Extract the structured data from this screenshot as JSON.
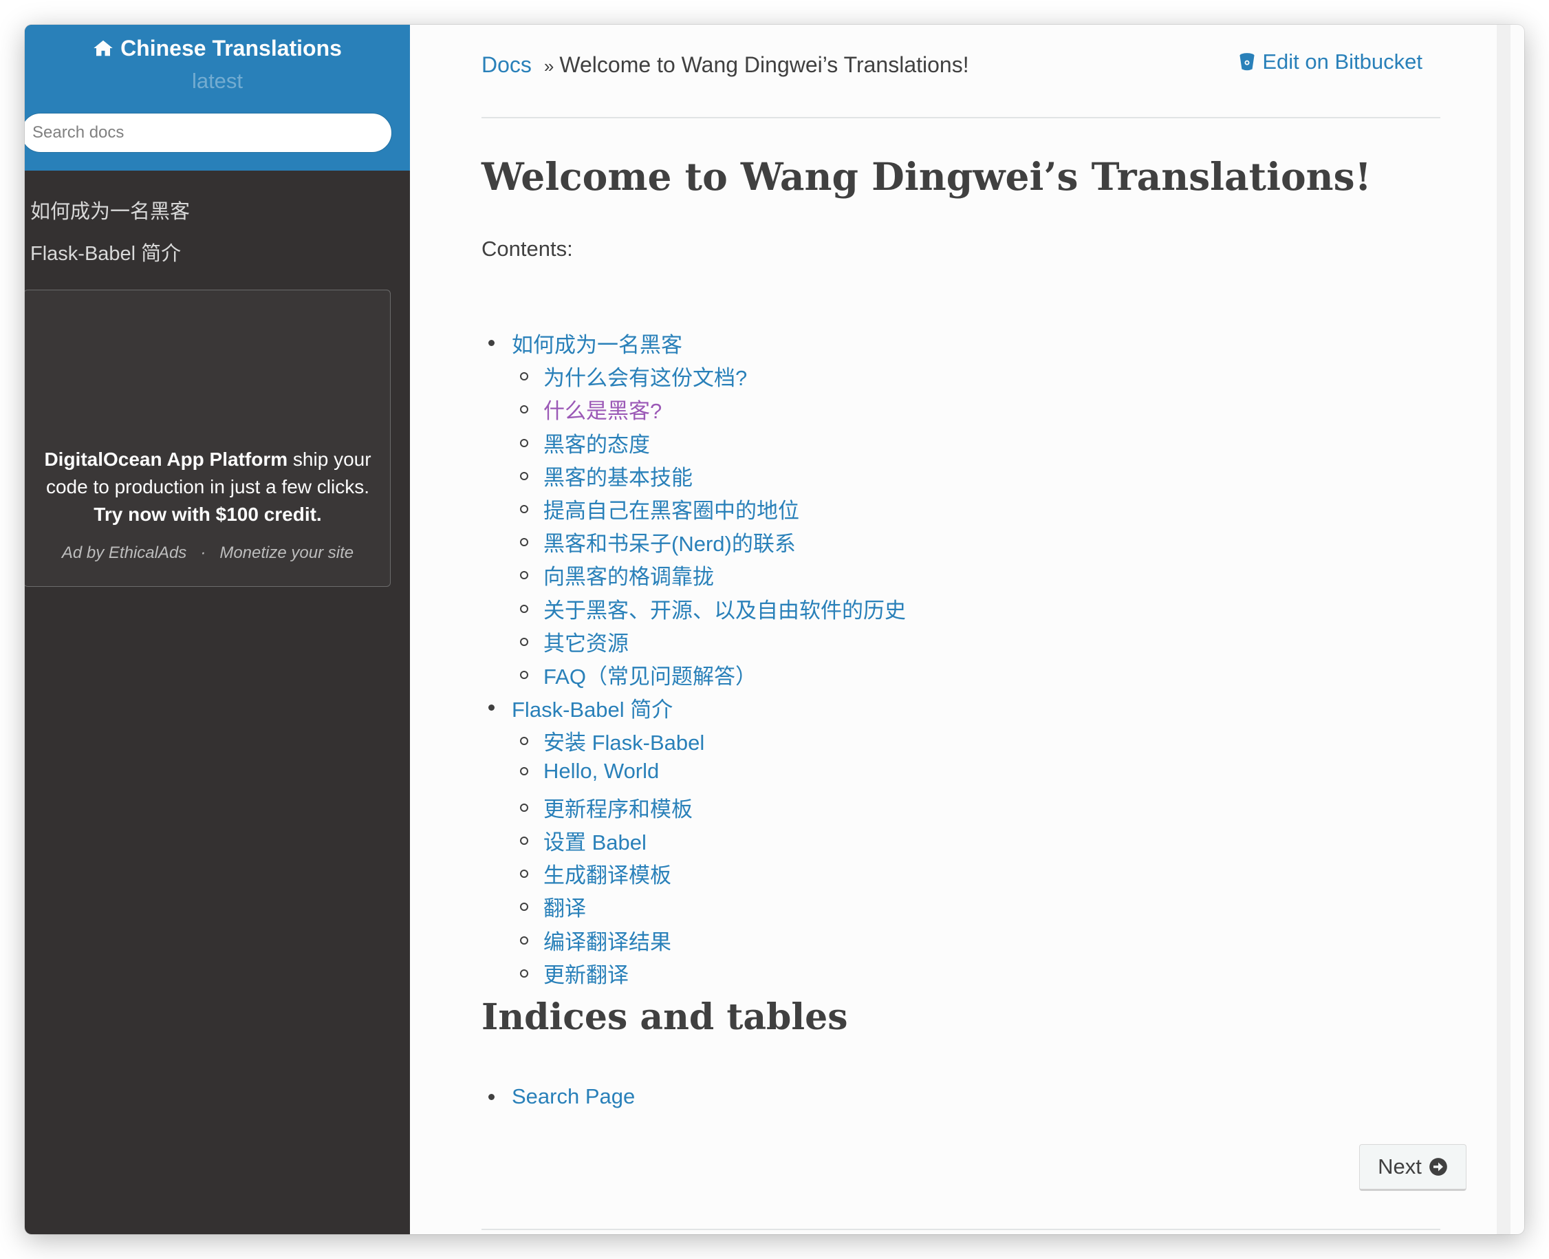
{
  "sidebar": {
    "project_title": "Chinese Translations",
    "version": "latest",
    "search_placeholder": "Search docs",
    "nav_items": [
      {
        "label": "如何成为一名黑客"
      },
      {
        "label": "Flask-Babel 简介"
      }
    ],
    "ad": {
      "brand": "DigitalOcean App Platform",
      "text": " ship your code to production in just a few clicks.",
      "cta": "Try now with $100 credit.",
      "footer_left": "Ad by EthicalAds",
      "footer_sep": "·",
      "footer_right": "Monetize your site"
    }
  },
  "header": {
    "breadcrumb_home": "Docs",
    "breadcrumb_sep": "»",
    "breadcrumb_current": "Welcome to Wang Dingwei’s Translations!",
    "edit_link": "Edit on Bitbucket"
  },
  "main": {
    "title": "Welcome to Wang Dingwei’s Translations!",
    "contents_label": "Contents:",
    "toc": [
      {
        "label": "如何成为一名黑客",
        "level": 1
      },
      {
        "label": "为什么会有这份文档?",
        "level": 2
      },
      {
        "label": "什么是黑客?",
        "level": 2,
        "visited": true
      },
      {
        "label": "黑客的态度",
        "level": 2
      },
      {
        "label": "黑客的基本技能",
        "level": 2
      },
      {
        "label": "提高自己在黑客圈中的地位",
        "level": 2
      },
      {
        "label": "黑客和书呆子(Nerd)的联系",
        "level": 2
      },
      {
        "label": "向黑客的格调靠拢",
        "level": 2
      },
      {
        "label": "关于黑客、开源、以及自由软件的历史",
        "level": 2
      },
      {
        "label": "其它资源",
        "level": 2
      },
      {
        "label": "FAQ（常见问题解答）",
        "level": 2
      },
      {
        "label": "Flask-Babel 简介",
        "level": 1
      },
      {
        "label": "安装 Flask-Babel",
        "level": 2
      },
      {
        "label": "Hello, World",
        "level": 2
      },
      {
        "label": "更新程序和模板",
        "level": 2
      },
      {
        "label": "设置 Babel",
        "level": 2
      },
      {
        "label": "生成翻译模板",
        "level": 2
      },
      {
        "label": "翻译",
        "level": 2
      },
      {
        "label": "编译翻译结果",
        "level": 2
      },
      {
        "label": "更新翻译",
        "level": 2
      }
    ],
    "indices_title": "Indices and tables",
    "indices_link": "Search Page",
    "next_label": "Next"
  },
  "colors": {
    "sidebar_bg": "#343131",
    "header_blue": "#2980b9",
    "link": "#2980b9",
    "visited_link": "#9b59b6",
    "text": "#404040"
  },
  "icons": [
    "home-icon",
    "bitbucket-icon",
    "arrow-circle-right-icon"
  ]
}
